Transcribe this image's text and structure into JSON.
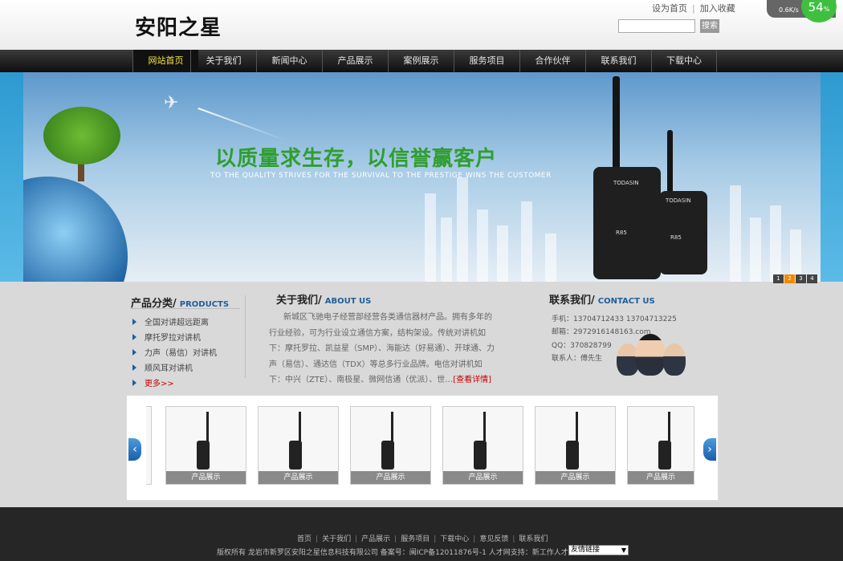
{
  "site": {
    "logo": "安阳之星"
  },
  "toplinks": {
    "home": "设为首页",
    "fav": "加入收藏",
    "sep": "|"
  },
  "search": {
    "button": "搜索"
  },
  "speed": {
    "rate": "0.6K/s",
    "percent": "54",
    "percent_sign": "%"
  },
  "nav": [
    "网站首页",
    "关于我们",
    "新闻中心",
    "产品展示",
    "案例展示",
    "服务项目",
    "合作伙伴",
    "联系我们",
    "下载中心"
  ],
  "banner": {
    "slogan": "以质量求生存，以信誉赢客户",
    "slogan_en": "TO THE QUALITY STRIVES FOR THE SURVIVAL TO THE PRESTIGE WINS THE CUSTOMER",
    "brand": "TODASIN",
    "model": "R85",
    "slides": [
      "1",
      "2",
      "3",
      "4"
    ],
    "active_slide": 2
  },
  "products": {
    "title": "产品分类/",
    "subtitle": "PRODUCTS",
    "items": [
      "全国对讲超远距离",
      "摩托罗拉对讲机",
      "力声（易信）对讲机",
      "顺风耳对讲机"
    ],
    "more": "更多>>"
  },
  "about": {
    "title": "关于我们/",
    "subtitle": "ABOUT US",
    "text": "新城区飞驰电子经营部经营各类通信器材产品。拥有多年的行业经验，可为行业设立通信方案，结构架设。传统对讲机如下：摩托罗拉、凯益星（SMP）、海能达（好易通）、开球通、力声（易信）、通达信（TDX）等总多行业品牌。电信对讲机如下：中兴（ZTE）、南极星、微网信通（优派）、世…",
    "more": "[查看详情]"
  },
  "contact": {
    "title": "联系我们/",
    "subtitle": "CONTACT US",
    "phone": "手机：13704712433 13704713225",
    "email": "邮箱：2972916148163.com",
    "qq": "QQ：370828799",
    "person": "联系人：傅先生"
  },
  "gallery": {
    "prev": "‹",
    "next": "›",
    "items": [
      "产品展示",
      "产品展示",
      "产品展示",
      "产品展示",
      "产品展示",
      "产品展示"
    ]
  },
  "footer": {
    "links": [
      "首页",
      "关于我们",
      "产品展示",
      "服务项目",
      "下载中心",
      "意见反馈",
      "联系我们"
    ],
    "sep": "|",
    "copyright": "版权所有 龙岩市新罗区安阳之星信息科技有限公司 备案号：闽ICP备12011876号-1 人才网支持：新工作人才网",
    "friend_links": "友情链接"
  }
}
